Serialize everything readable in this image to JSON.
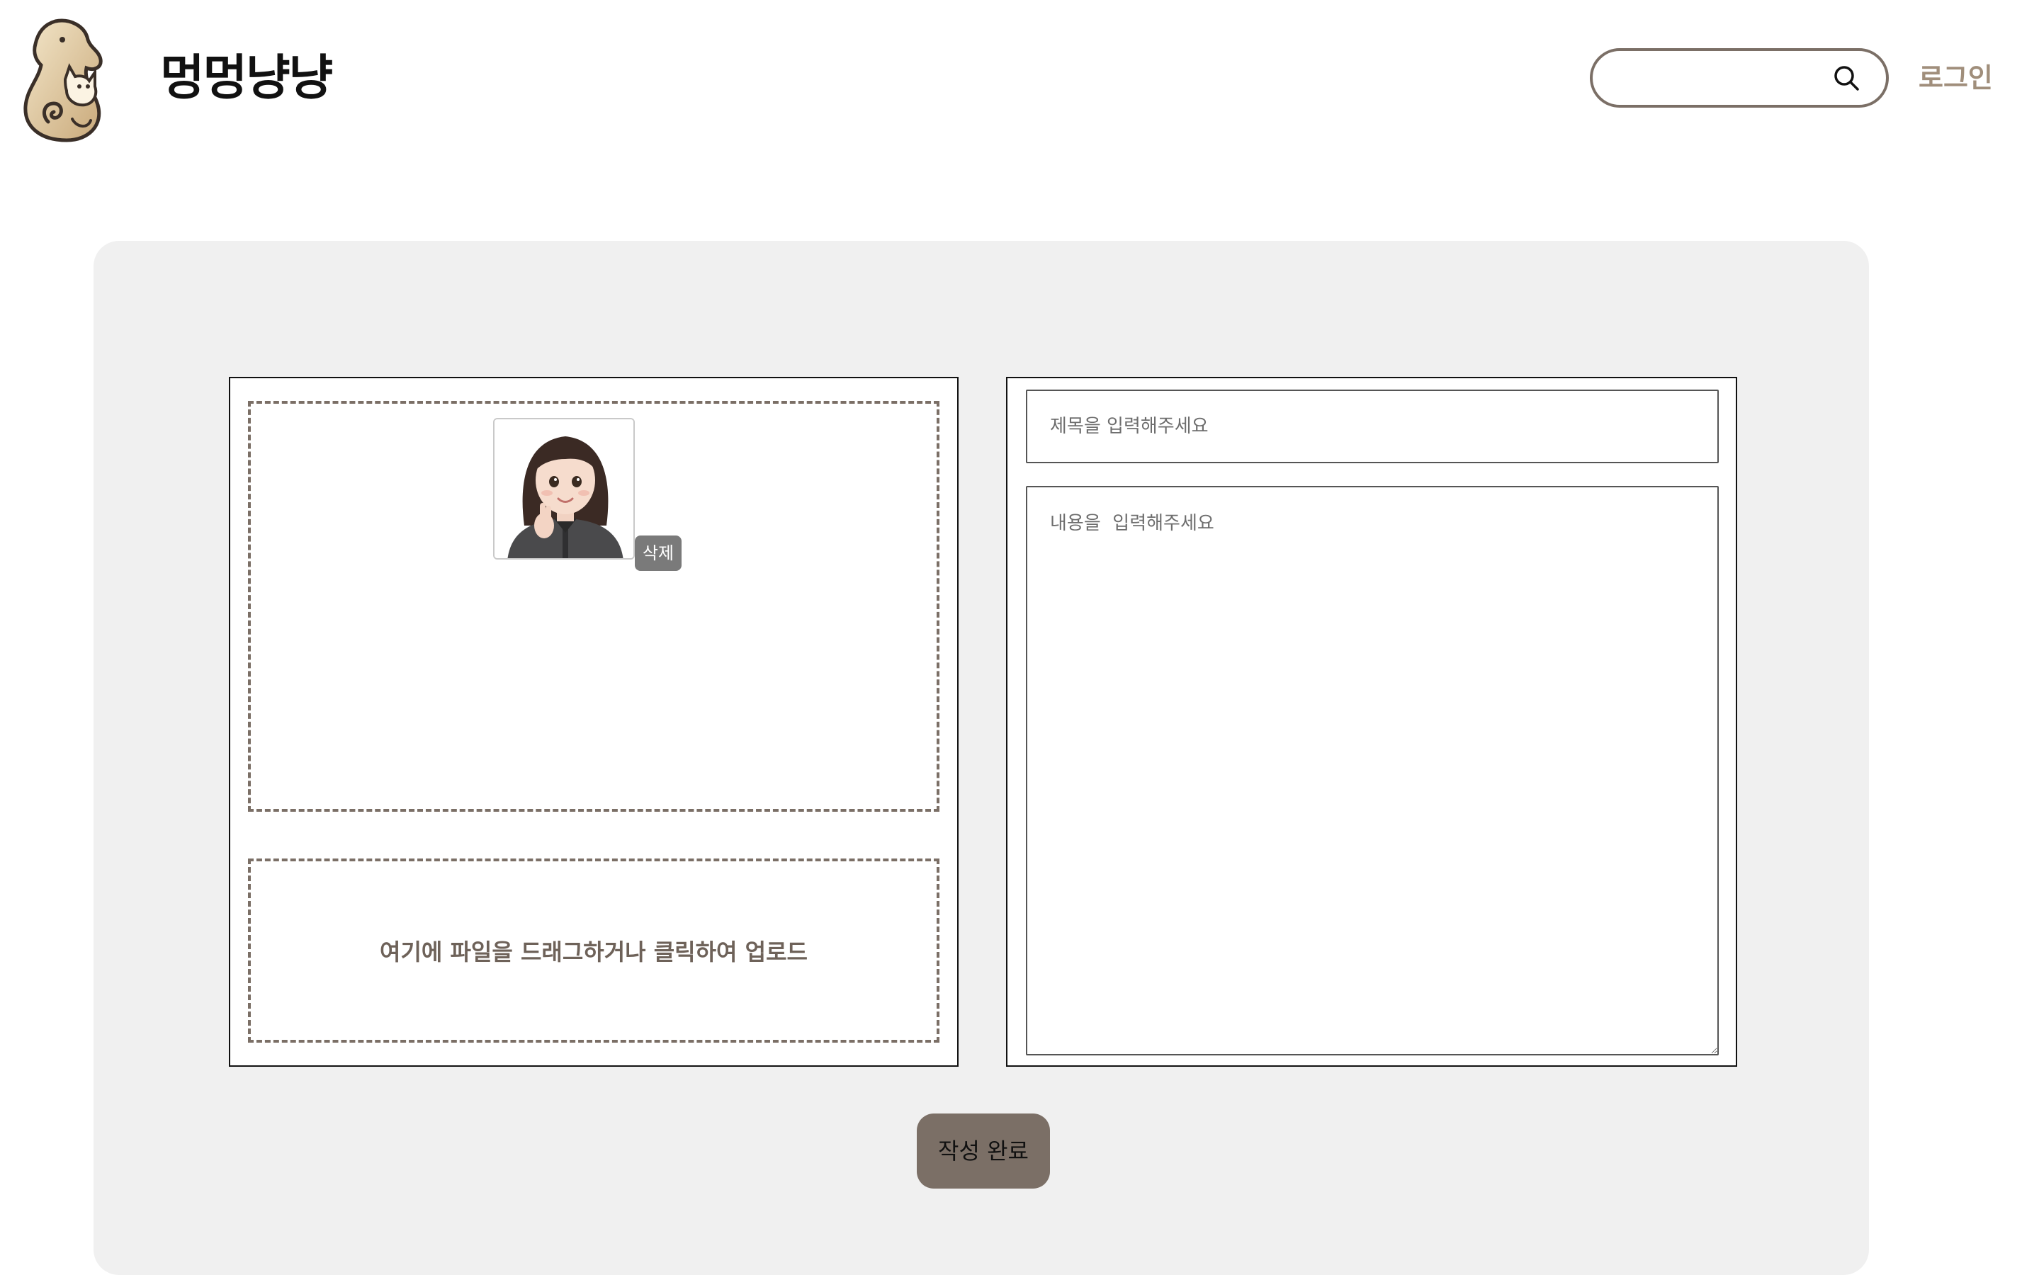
{
  "header": {
    "logo_icon": "dog-cat-logo-icon",
    "brand": "멍멍냥냥",
    "search": {
      "value": "",
      "placeholder": "",
      "icon": "search-icon"
    },
    "login_label": "로그인"
  },
  "editor": {
    "images": [
      {
        "icon": "avatar-image",
        "delete_label": "삭제"
      }
    ],
    "upload_label": "여기에 파일을 드래그하거나 클릭하여 업로드",
    "title_placeholder": "제목을 입력해주세요",
    "content_placeholder": "내용을  입력해주세요",
    "submit_label": "작성 완료"
  },
  "colors": {
    "accent": "#7b6f66",
    "login": "#a08e7b",
    "panel_bg": "#f0f0f0",
    "delete_bg": "#7a7a7a"
  }
}
